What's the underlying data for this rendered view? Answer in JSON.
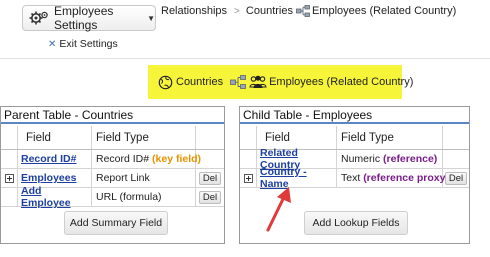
{
  "toolbar": {
    "settings_label": "Employees Settings",
    "exit_label": "Exit Settings"
  },
  "breadcrumb": {
    "relationships": "Relationships",
    "countries": "Countries",
    "employees_related": "Employees (Related Country)"
  },
  "highlight": {
    "countries": "Countries",
    "employees_related": "Employees (Related Country)"
  },
  "parent_table": {
    "title": "Parent Table - Countries",
    "headers": {
      "field": "Field",
      "type": "Field Type"
    },
    "rows": [
      {
        "name": "Record ID#",
        "type": "Record ID#",
        "tag": "(key field)",
        "action": ""
      },
      {
        "name": "Employees",
        "type": "Report Link",
        "tag": "",
        "action": "Del"
      },
      {
        "name": "Add Employee",
        "type": "URL (formula)",
        "tag": "",
        "action": "Del"
      }
    ],
    "button": "Add Summary Field"
  },
  "child_table": {
    "title": "Child Table - Employees",
    "headers": {
      "field": "Field",
      "type": "Field Type"
    },
    "rows": [
      {
        "name": "Related Country",
        "type": "Numeric",
        "tag": "(reference)",
        "action": ""
      },
      {
        "name": "Country - Name",
        "type": "Text",
        "tag": "(reference proxy)",
        "action": "Del"
      }
    ],
    "button": "Add Lookup Fields"
  },
  "colors": {
    "highlight": "#f7f53a",
    "link": "#1c3fa0",
    "key_field": "#e79200",
    "reference": "#7a1c8c",
    "arrow": "#e03a3a"
  }
}
